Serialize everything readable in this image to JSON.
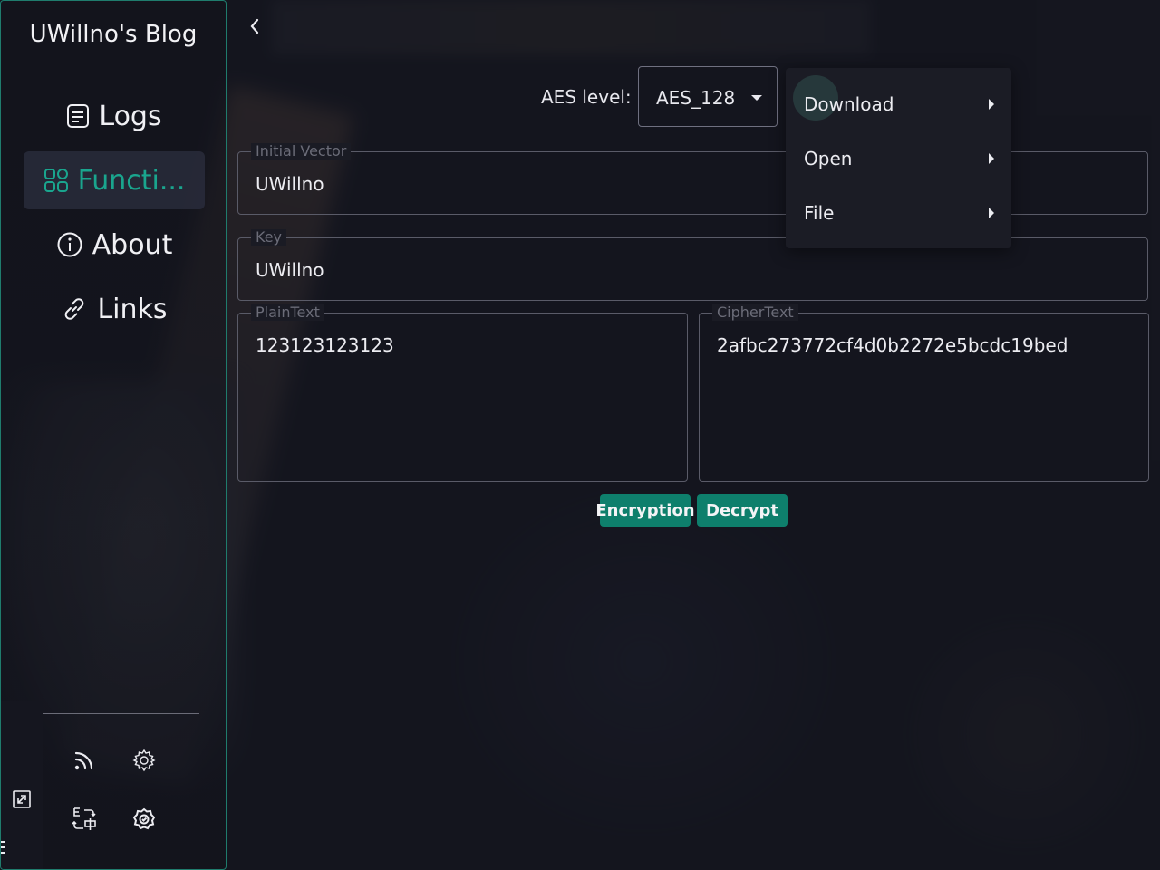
{
  "sidebar": {
    "title": "UWillno's Blog",
    "items": [
      {
        "label": "Logs",
        "icon": "document-icon"
      },
      {
        "label": "Functi...",
        "icon": "apps-grid-icon",
        "active": true
      },
      {
        "label": "About",
        "icon": "info-circle-icon"
      },
      {
        "label": "Links",
        "icon": "link-icon"
      }
    ],
    "tools": [
      "rss-icon",
      "gear-icon",
      "translate-icon",
      "settings-badge-icon"
    ],
    "expand_icon": "expand-icon"
  },
  "main": {
    "aes_label": "AES level:",
    "aes_value": "AES_128",
    "initial_vector": {
      "label": "Initial Vector",
      "value": "UWillno"
    },
    "key": {
      "label": "Key",
      "value": "UWillno"
    },
    "plaintext": {
      "label": "PlainText",
      "value": "123123123123"
    },
    "ciphertext": {
      "label": "CipherText",
      "value": "2afbc273772cf4d0b2272e5bcdc19bed"
    },
    "encrypt_label": "Encryption",
    "decrypt_label": "Decrypt"
  },
  "context_menu": {
    "items": [
      {
        "label": "Download"
      },
      {
        "label": "Open"
      },
      {
        "label": "File"
      }
    ]
  },
  "colors": {
    "accent": "#1aa58e",
    "button": "#0e7f6c",
    "background": "#15161f"
  }
}
